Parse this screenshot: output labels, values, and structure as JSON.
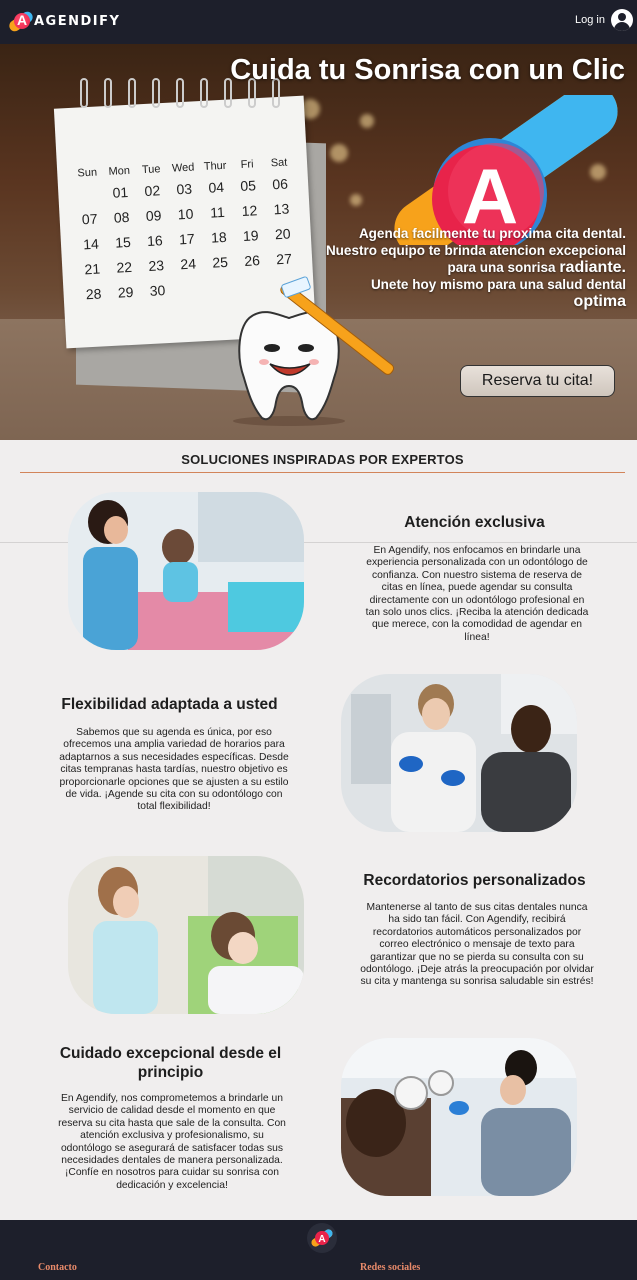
{
  "brand": {
    "name": "AGENDIFY",
    "logo_letter": "A"
  },
  "nav": {
    "login_label": "Log in"
  },
  "hero": {
    "title": "Cuida tu Sonrisa con un Clic",
    "desc_line1": "Agenda facilmente tu proxima cita dental. Nuestro equipo te brinda atencion excepcional para una sonrisa",
    "desc_highlight1": "radiante.",
    "desc_line2": "Unete hoy mismo para una salud dental",
    "desc_highlight2": "optima",
    "cta_label": "Reserva tu cita!",
    "calendar": {
      "days": [
        "Sun",
        "Mon",
        "Tue",
        "Wed",
        "Thur",
        "Fri",
        "Sat"
      ],
      "dates": [
        "",
        "01",
        "02",
        "03",
        "04",
        "05",
        "06",
        "07",
        "08",
        "09",
        "10",
        "11",
        "12",
        "13",
        "14",
        "15",
        "16",
        "17",
        "18",
        "19",
        "20",
        "21",
        "22",
        "23",
        "24",
        "25",
        "26",
        "27",
        "28",
        "29",
        "30",
        "",
        "",
        "",
        ""
      ]
    }
  },
  "section": {
    "title": "SOLUCIONES INSPIRADAS POR EXPERTOS",
    "features": [
      {
        "title": "Atención exclusiva",
        "text": "En Agendify, nos enfocamos en brindarle una experiencia personalizada con un odontólogo de confianza. Con nuestro sistema de reserva de citas en línea, puede agendar su consulta directamente con un odontólogo profesional en tan solo unos clics. ¡Reciba la atención dedicada que merece, con la comodidad de agendar en línea!"
      },
      {
        "title": "Flexibilidad adaptada a usted",
        "text": "Sabemos que su agenda es única, por eso ofrecemos una amplia variedad de horarios para adaptarnos a sus necesidades específicas. Desde citas tempranas hasta tardías, nuestro objetivo es proporcionarle opciones que se ajusten a su estilo de vida. ¡Agende su cita con su odontólogo con total flexibilidad!"
      },
      {
        "title": "Recordatorios personalizados",
        "text": "Mantenerse al tanto de sus citas dentales nunca ha sido tan fácil. Con Agendify, recibirá recordatorios automáticos personalizados por correo electrónico o mensaje de texto para garantizar que no se pierda su consulta con su odontólogo. ¡Deje atrás la preocupación por olvidar su cita y mantenga su sonrisa saludable sin estrés!"
      },
      {
        "title": "Cuidado excepcional desde el principio",
        "text": "En Agendify, nos comprometemos a brindarle un servicio de calidad desde el momento en que reserva su cita hasta que sale de la consulta. Con atención exclusiva y profesionalismo, su odontólogo se asegurará de satisfacer todas sus necesidades dentales de manera personalizada. ¡Confíe en nosotros para cuidar su sonrisa con dedicación y excelencia!"
      }
    ]
  },
  "footer": {
    "contact_label": "Contacto",
    "social_label": "Redes sociales"
  },
  "colors": {
    "nav_bg": "#1d1f2b",
    "accent": "#d2845a",
    "footer_link": "#e88a6a",
    "brand_orange": "#f7a21b",
    "brand_red": "#e8234a",
    "brand_blue": "#3fb6f0"
  }
}
